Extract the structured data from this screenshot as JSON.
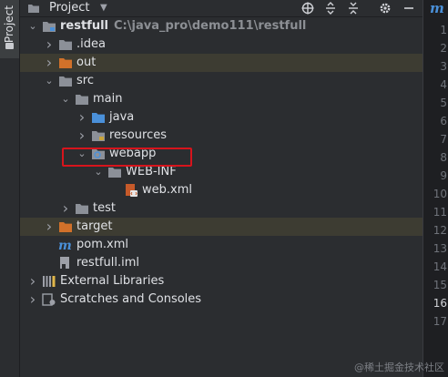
{
  "sidebar": {
    "tab_label": "Project"
  },
  "header": {
    "title": "Project",
    "caret": "▼"
  },
  "tree": [
    {
      "label": "restfull",
      "path": "C:\\java_pro\\demo111\\restfull",
      "depth": 0,
      "chevron": "down",
      "icon": "module-folder-icon"
    },
    {
      "label": ".idea",
      "depth": 1,
      "chevron": "right",
      "icon": "folder-icon"
    },
    {
      "label": "out",
      "depth": 1,
      "chevron": "right",
      "icon": "excluded-folder-icon",
      "highlight": true
    },
    {
      "label": "src",
      "depth": 1,
      "chevron": "down",
      "icon": "folder-icon"
    },
    {
      "label": "main",
      "depth": 2,
      "chevron": "down",
      "icon": "folder-icon"
    },
    {
      "label": "java",
      "depth": 3,
      "chevron": "right",
      "icon": "source-folder-icon"
    },
    {
      "label": "resources",
      "depth": 3,
      "chevron": "right",
      "icon": "resources-folder-icon"
    },
    {
      "label": "webapp",
      "depth": 3,
      "chevron": "down",
      "icon": "web-folder-icon",
      "selected": true
    },
    {
      "label": "WEB-INF",
      "depth": 4,
      "chevron": "down",
      "icon": "folder-icon"
    },
    {
      "label": "web.xml",
      "depth": 5,
      "chevron": "none",
      "icon": "xml-file-icon"
    },
    {
      "label": "test",
      "depth": 2,
      "chevron": "right",
      "icon": "folder-icon"
    },
    {
      "label": "target",
      "depth": 1,
      "chevron": "right",
      "icon": "excluded-folder-icon",
      "highlight": true
    },
    {
      "label": "pom.xml",
      "depth": 1,
      "chevron": "none",
      "icon": "maven-icon"
    },
    {
      "label": "restfull.iml",
      "depth": 1,
      "chevron": "none",
      "icon": "iml-file-icon"
    },
    {
      "label": "External Libraries",
      "depth": 0,
      "chevron": "right",
      "icon": "libraries-icon"
    },
    {
      "label": "Scratches and Consoles",
      "depth": 0,
      "chevron": "right",
      "icon": "scratches-icon"
    }
  ],
  "gutter": {
    "logo": "m",
    "line_numbers": [
      "1",
      "2",
      "3",
      "4",
      "5",
      "6",
      "7",
      "8",
      "9",
      "10",
      "11",
      "12",
      "13",
      "14",
      "15",
      "16",
      "17"
    ],
    "active_line": "16"
  },
  "watermark": "@稀土掘金技术社区",
  "colors": {
    "folder": "#8c9098",
    "excluded_folder": "#d1712a",
    "source_folder": "#4a90d9",
    "selection_frame": "#d7141c",
    "highlight_row": "#3d3c32"
  }
}
